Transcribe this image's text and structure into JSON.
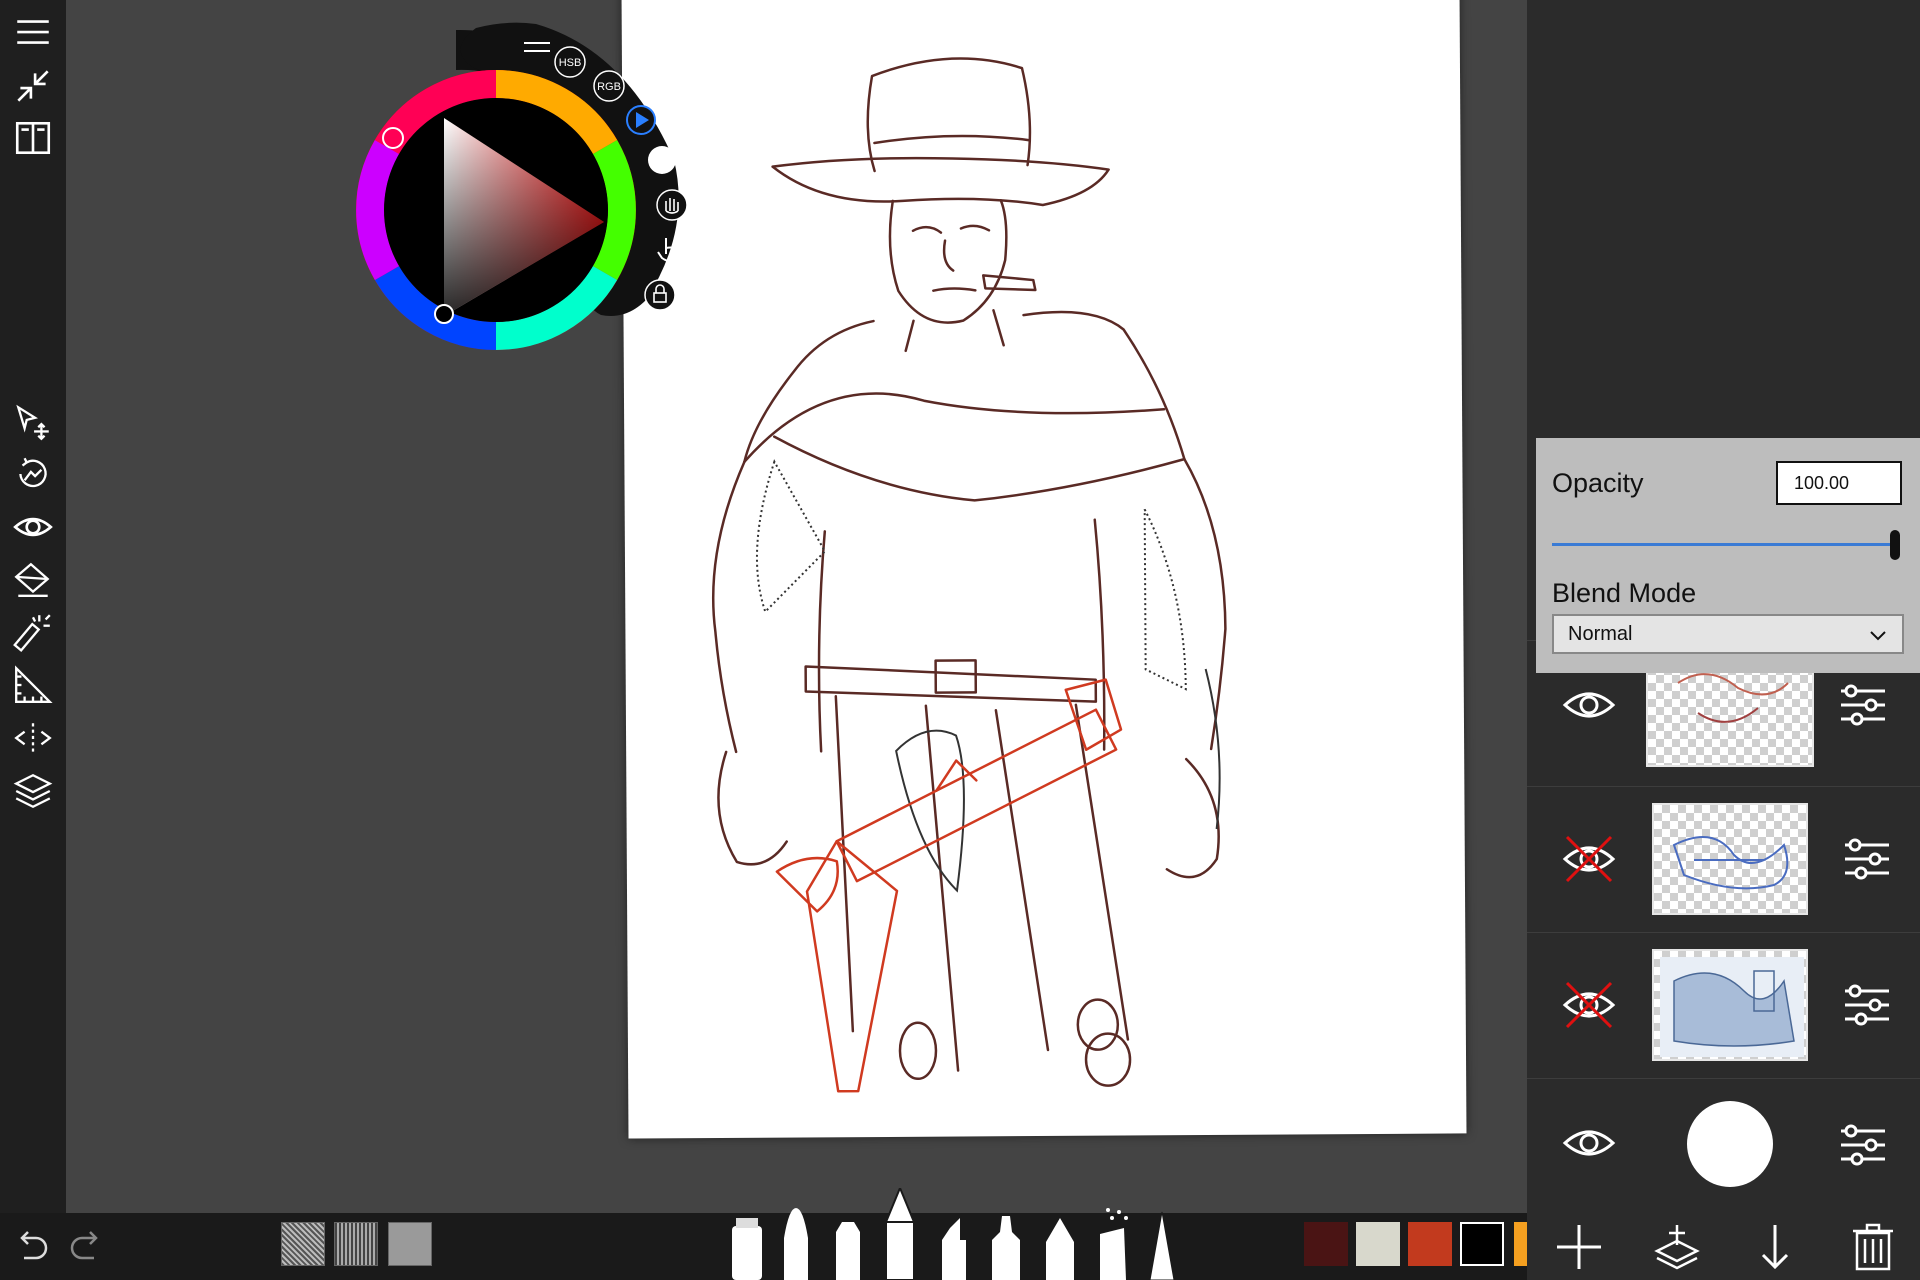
{
  "app": {
    "left_toolbar": {
      "top_tools": [
        "menu-icon",
        "collapse-icon",
        "gallery-icon"
      ],
      "tools": [
        "select-transform-icon",
        "transform-icon",
        "visibility-icon",
        "fill-icon",
        "magic-wand-icon",
        "ruler-icon",
        "symmetry-icon",
        "layers-icon"
      ]
    },
    "color_puck": {
      "menu": "menu-icon",
      "hsb_label": "HSB",
      "rgb_label": "RGB",
      "current_color": "#ff0000",
      "tools": [
        "play-icon",
        "color-dot-icon",
        "hand-icon",
        "touch-icon",
        "lock-icon"
      ]
    },
    "layer_properties": {
      "opacity_label": "Opacity",
      "opacity_value": "100.00",
      "opacity_fraction": 1.0,
      "blend_mode_label": "Blend Mode",
      "blend_mode_value": "Normal"
    },
    "layers": [
      {
        "visible": true,
        "thumbnail": "red-sketch"
      },
      {
        "visible": false,
        "thumbnail": "blue-sketch"
      },
      {
        "visible": false,
        "thumbnail": "reference-photo"
      }
    ],
    "background_layer": {
      "visible": true,
      "color": "#ffffff"
    },
    "layer_actions": [
      "add-layer-icon",
      "merge-layer-icon",
      "move-down-icon",
      "delete-layer-icon"
    ],
    "bottom_bar": {
      "history": [
        "undo-icon",
        "redo-icon"
      ],
      "textures": [
        "texture-noise",
        "texture-weave",
        "texture-flat"
      ],
      "brushes": [
        "eraser",
        "paint-brush",
        "marker",
        "pencil",
        "chisel-marker",
        "felt-pen",
        "fountain-pen",
        "airbrush",
        "smudge-cone"
      ],
      "swatches": [
        "#4a1414",
        "#d8d8cc",
        "#c23a1e",
        "#000000",
        "#f5a020"
      ]
    },
    "colors": {
      "accent": "#3a7bd5",
      "sketch_dark": "#5a2a25",
      "sketch_red": "#d03a20"
    }
  }
}
